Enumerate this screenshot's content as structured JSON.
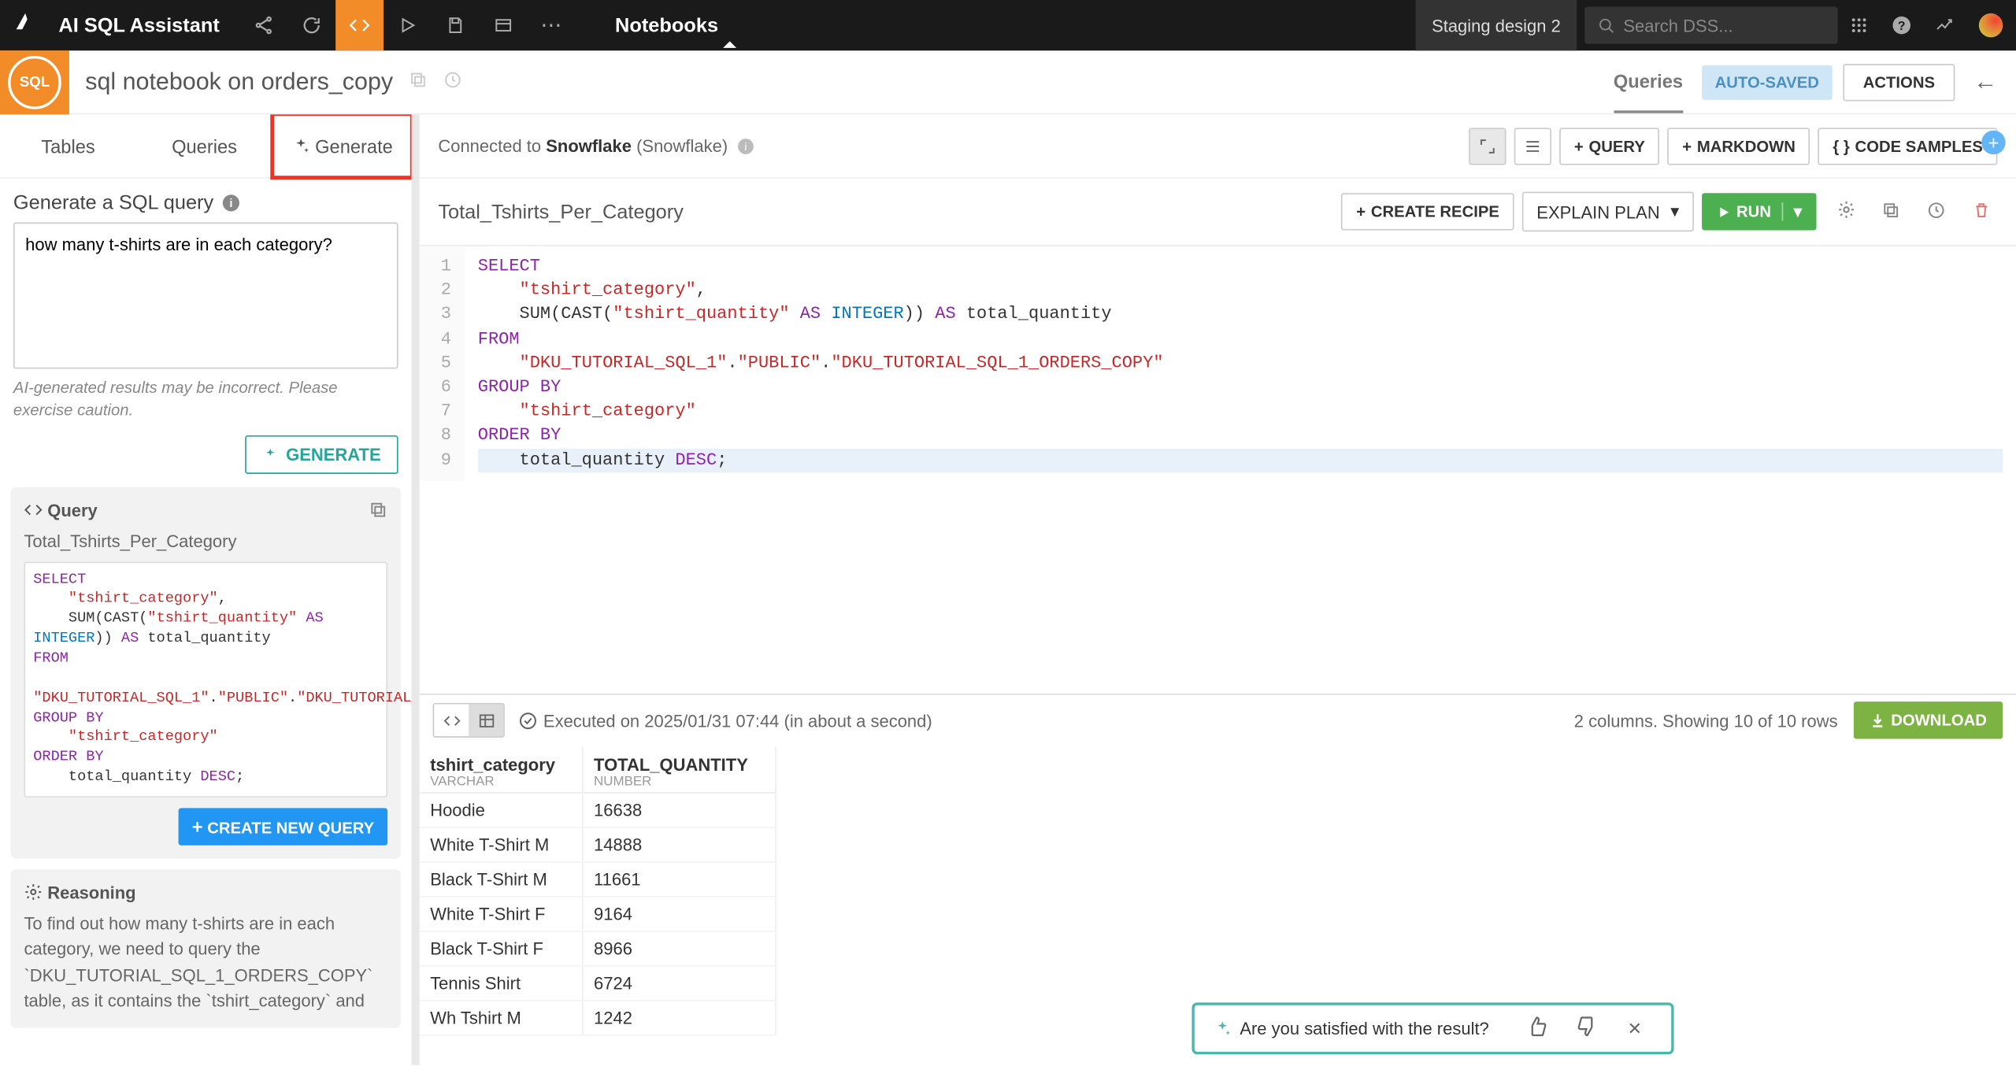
{
  "topbar": {
    "app_title": "AI SQL Assistant",
    "notebooks_label": "Notebooks",
    "staging_label": "Staging design 2",
    "search_placeholder": "Search DSS..."
  },
  "subheader": {
    "badge": "SQL",
    "title": "sql notebook on orders_copy",
    "tab_queries": "Queries",
    "autosaved": "AUTO-SAVED",
    "actions": "ACTIONS"
  },
  "left": {
    "tab_tables": "Tables",
    "tab_queries": "Queries",
    "tab_generate": "Generate",
    "gen_header": "Generate a SQL query",
    "prompt": "how many t-shirts are in each category?",
    "disclaimer": "AI-generated results may be incorrect. Please exercise caution.",
    "gen_button": "GENERATE",
    "query_card": {
      "label": "Query",
      "name": "Total_Tshirts_Per_Category",
      "create_new": "CREATE NEW QUERY"
    },
    "reasoning": {
      "label": "Reasoning",
      "text": "To find out how many t-shirts are in each category, we need to query the `DKU_TUTORIAL_SQL_1_ORDERS_COPY` table, as it contains the `tshirt_category` and"
    }
  },
  "right": {
    "connected_prefix": "Connected to ",
    "conn_name": "Snowflake",
    "conn_paren": "(Snowflake)",
    "tb_query": "QUERY",
    "tb_markdown": "MARKDOWN",
    "tb_codesamples": "CODE SAMPLES",
    "query_title": "Total_Tshirts_Per_Category",
    "create_recipe": "CREATE RECIPE",
    "explain_plan": "EXPLAIN PLAN",
    "run": "RUN",
    "exec_text": "Executed on 2025/01/31 07:44 (in about a second)",
    "cols_info": "2 columns. Showing 10 of 10 rows",
    "download": "DOWNLOAD",
    "table": {
      "col1": "tshirt_category",
      "col1_type": "VARCHAR",
      "col2": "TOTAL_QUANTITY",
      "col2_type": "NUMBER",
      "rows": [
        [
          "Hoodie",
          "16638"
        ],
        [
          "White T-Shirt M",
          "14888"
        ],
        [
          "Black T-Shirt M",
          "11661"
        ],
        [
          "White T-Shirt F",
          "9164"
        ],
        [
          "Black T-Shirt F",
          "8966"
        ],
        [
          "Tennis Shirt",
          "6724"
        ],
        [
          "Wh Tshirt M",
          "1242"
        ]
      ]
    },
    "feedback_text": "Are you satisfied with the result?"
  }
}
